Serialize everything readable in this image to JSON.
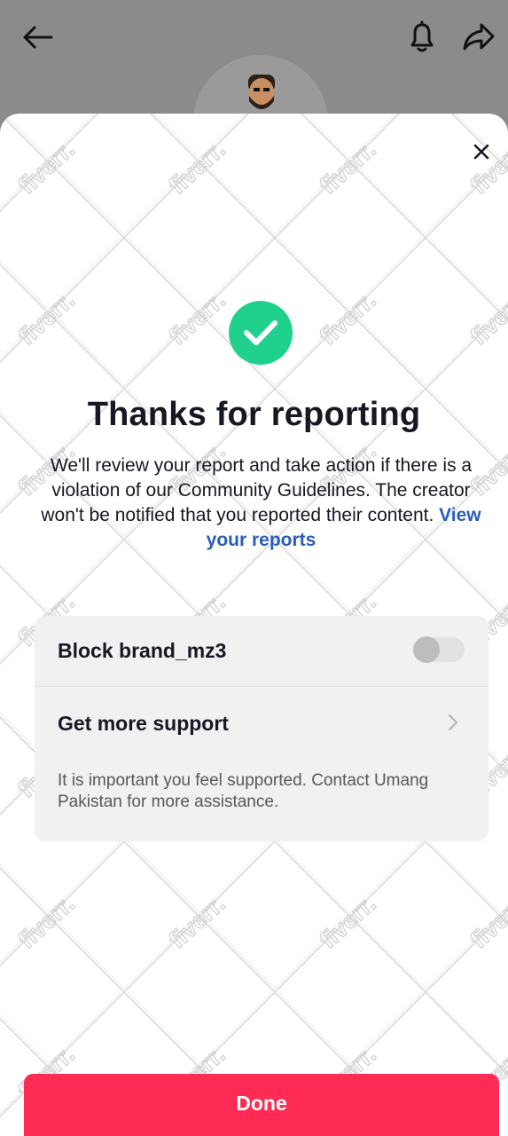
{
  "header": {
    "back_icon": "back-arrow-icon",
    "bell_icon": "bell-icon",
    "share_icon": "share-arrow-icon"
  },
  "modal": {
    "close_icon": "close-icon",
    "success_icon": "check-circle-icon",
    "title": "Thanks for reporting",
    "description": "We'll review your report and take action if there is a violation of our Community Guidelines. The creator won't be notified that you reported their content.",
    "link_label": "View your reports",
    "block_label": "Block brand_mz3",
    "block_enabled": false,
    "support_label": "Get more support",
    "support_description": "It is important you feel supported. Contact Umang Pakistan for more assistance.",
    "done_label": "Done"
  },
  "watermark_text": "fiverr.",
  "colors": {
    "accent": "#fe2c55",
    "success": "#1fd18c",
    "link": "#2b5db9"
  }
}
